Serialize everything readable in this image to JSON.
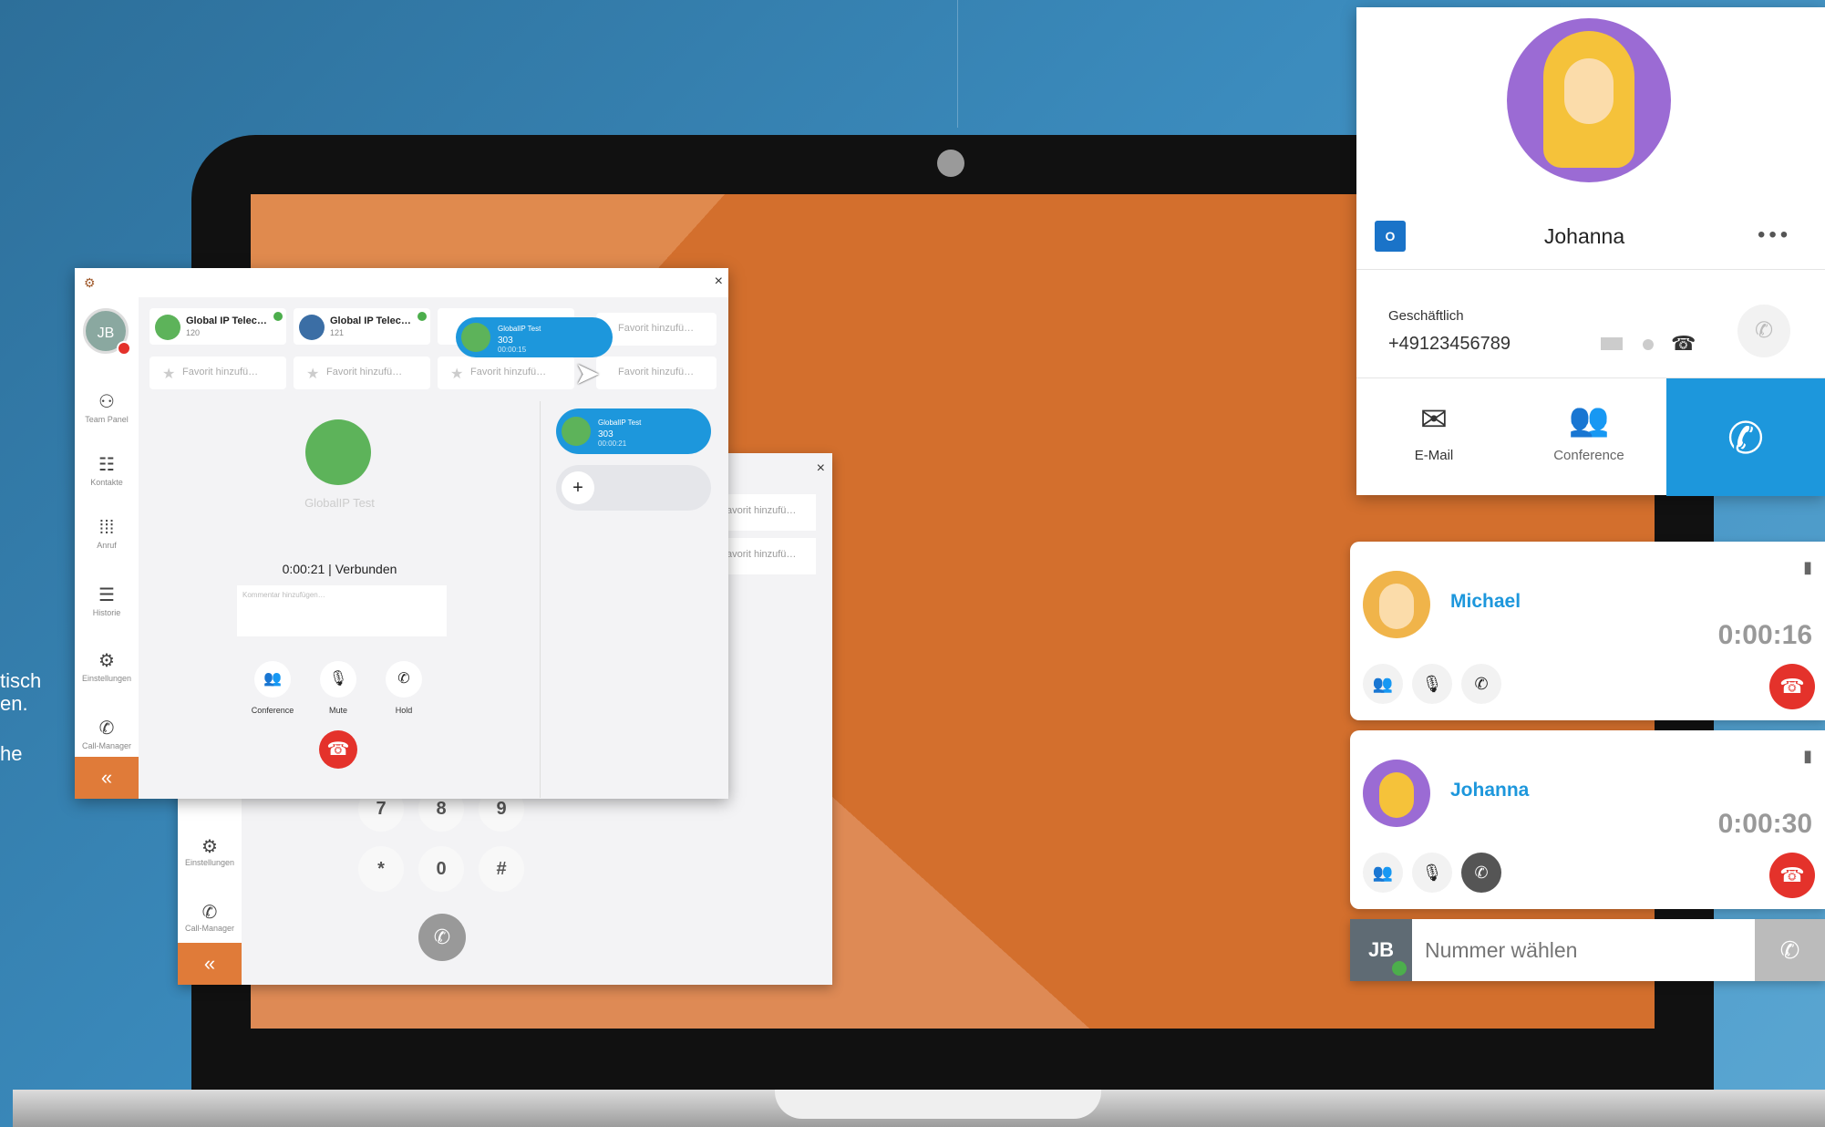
{
  "background": {
    "accent": "#1d97dc",
    "screen": "#d36f2d"
  },
  "left_text": {
    "line1": "tisch",
    "line2": "en.",
    "line3": "he"
  },
  "app": {
    "avatar_initials": "JB",
    "nav": [
      {
        "label": "Team Panel",
        "icon": "team-icon"
      },
      {
        "label": "Kontakte",
        "icon": "contacts-icon"
      },
      {
        "label": "Anruf",
        "icon": "dialpad-icon"
      },
      {
        "label": "Historie",
        "icon": "history-icon"
      },
      {
        "label": "Einstellungen",
        "icon": "gear-icon"
      },
      {
        "label": "Call-Manager",
        "icon": "call-manager-icon"
      }
    ],
    "collapse": "«",
    "contacts": [
      {
        "name": "Global IP Telec…",
        "ext": "120"
      },
      {
        "name": "Global IP Telec…",
        "ext": "121"
      }
    ],
    "fav_label": "Favorit hinzufü…",
    "dragging": {
      "l1": "GlobalIP Test",
      "l2": "303",
      "l3": "00:00:15"
    },
    "active_call": {
      "l1": "GlobalIP Test",
      "l2": "303",
      "l3": "00:00:21"
    },
    "add": "+",
    "caller_name": "GlobalIP Test",
    "status": "0:00:21 | Verbunden",
    "comment_placeholder": "Kommentar hinzufügen…",
    "controls": [
      {
        "label": "Conference",
        "icon": "conference-icon"
      },
      {
        "label": "Mute",
        "icon": "microphone-icon"
      },
      {
        "label": "Hold",
        "icon": "hold-icon"
      }
    ],
    "close": "×"
  },
  "back_app": {
    "dial_keys": [
      "7",
      "8",
      "9",
      "*",
      "0",
      "#"
    ],
    "nav": [
      {
        "label": "Einstellungen"
      },
      {
        "label": "Call-Manager"
      }
    ],
    "fav_label": "avorit hinzufü…",
    "collapse": "«",
    "close": "×"
  },
  "contact_card": {
    "name": "Johanna",
    "more": "•••",
    "phone_label": "Geschäftlich",
    "phone_number": "+49123456789",
    "actions": [
      {
        "label": "E-Mail",
        "icon": "envelope-icon"
      },
      {
        "label": "Conference",
        "icon": "conference-icon"
      },
      {
        "label": "",
        "icon": "phone-icon"
      }
    ]
  },
  "calls": [
    {
      "name": "Michael",
      "time": "0:00:16"
    },
    {
      "name": "Johanna",
      "time": "0:00:30"
    }
  ],
  "dialbar": {
    "initials": "JB",
    "placeholder": "Nummer wählen"
  }
}
